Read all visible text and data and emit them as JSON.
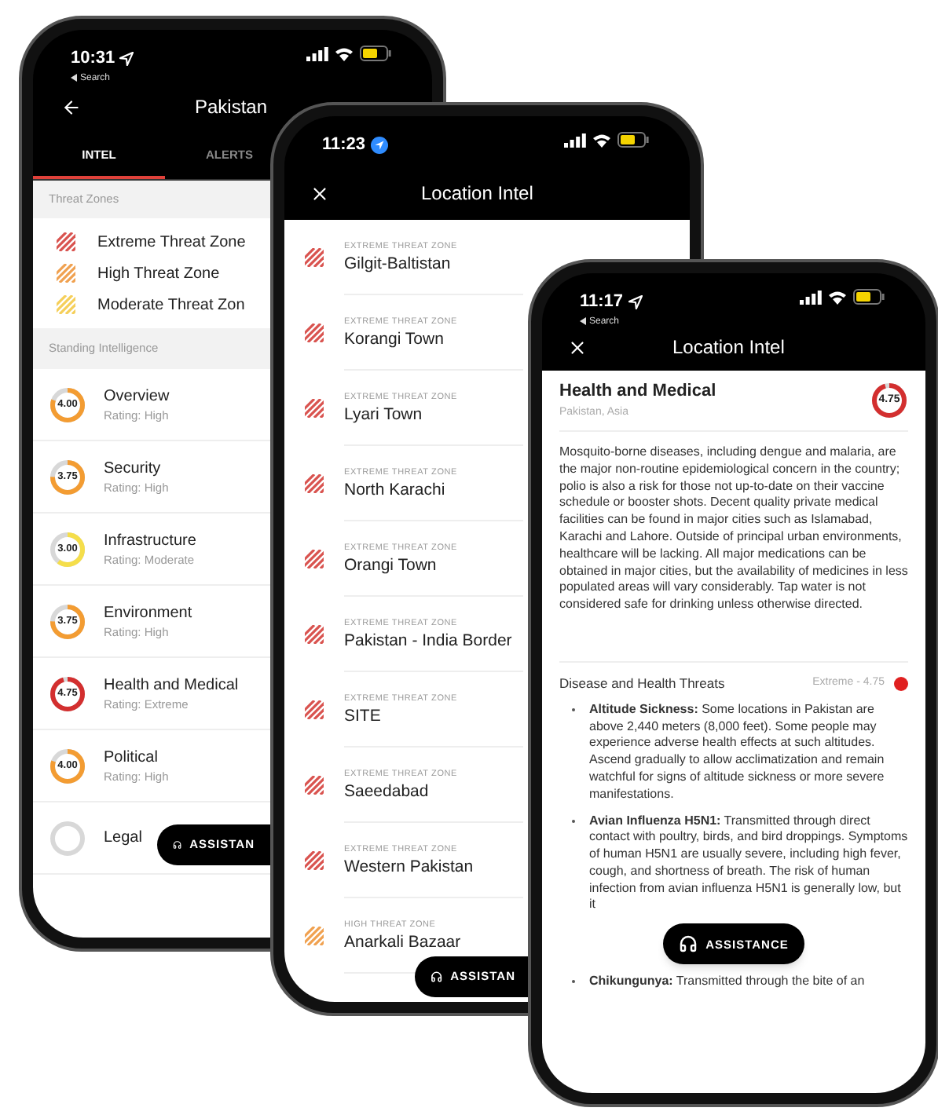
{
  "phone_country": {
    "status": {
      "time": "10:31",
      "back": "Search"
    },
    "title": "Pakistan",
    "tabs": [
      {
        "label": "INTEL",
        "selected": true
      },
      {
        "label": "ALERTS",
        "selected": false
      }
    ],
    "legend_header": "Threat Zones",
    "legend": [
      {
        "label": "Extreme Threat Zone",
        "color": "#d9534f"
      },
      {
        "label": "High Threat Zone",
        "color": "#f0a150"
      },
      {
        "label": "Moderate Threat Zon",
        "color": "#f5cf5a"
      }
    ],
    "section_header": "Standing Intelligence",
    "ratings": [
      {
        "name": "Overview",
        "rating": "Rating: High",
        "score": "4.00",
        "level": 0.8,
        "color": "#f39c32"
      },
      {
        "name": "Security",
        "rating": "Rating: High",
        "score": "3.75",
        "level": 0.75,
        "color": "#f39c32"
      },
      {
        "name": "Infrastructure",
        "rating": "Rating: Moderate",
        "score": "3.00",
        "level": 0.6,
        "color": "#f5de4a"
      },
      {
        "name": "Environment",
        "rating": "Rating: High",
        "score": "3.75",
        "level": 0.75,
        "color": "#f39c32"
      },
      {
        "name": "Health and Medical",
        "rating": "Rating: Extreme",
        "score": "4.75",
        "level": 0.95,
        "color": "#d32f2f"
      },
      {
        "name": "Political",
        "rating": "Rating: High",
        "score": "4.00",
        "level": 0.8,
        "color": "#f39c32"
      },
      {
        "name": "Legal"
      }
    ],
    "assist": "ASSISTAN"
  },
  "phone_zones": {
    "status": {
      "time": "11:23"
    },
    "title": "Location Intel",
    "zones": [
      {
        "label": "EXTREME THREAT ZONE",
        "name": "Gilgit-Baltistan",
        "color": "#d9534f"
      },
      {
        "label": "EXTREME THREAT ZONE",
        "name": "Korangi Town",
        "color": "#d9534f"
      },
      {
        "label": "EXTREME THREAT ZONE",
        "name": "Lyari Town",
        "color": "#d9534f"
      },
      {
        "label": "EXTREME THREAT ZONE",
        "name": "North Karachi",
        "color": "#d9534f"
      },
      {
        "label": "EXTREME THREAT ZONE",
        "name": "Orangi Town",
        "color": "#d9534f"
      },
      {
        "label": "EXTREME THREAT ZONE",
        "name": "Pakistan - India Border",
        "color": "#d9534f"
      },
      {
        "label": "EXTREME THREAT ZONE",
        "name": "SITE",
        "color": "#d9534f"
      },
      {
        "label": "EXTREME THREAT ZONE",
        "name": "Saeedabad",
        "color": "#d9534f"
      },
      {
        "label": "EXTREME THREAT ZONE",
        "name": "Western Pakistan",
        "color": "#d9534f"
      },
      {
        "label": "HIGH THREAT ZONE",
        "name": "Anarkali Bazaar",
        "color": "#f0a150"
      }
    ],
    "assist": "ASSISTAN"
  },
  "phone_detail": {
    "status": {
      "time": "11:17",
      "back": "Search"
    },
    "title": "Location Intel",
    "heading": "Health and Medical",
    "subtitle": "Pakistan, Asia",
    "score": "4.75",
    "level": 0.95,
    "color": "#d32f2f",
    "paragraph": "Mosquito-borne diseases, including dengue and malaria, are the major non-routine epidemiological concern in the country; polio is also a risk for those not up-to-date on their vaccine schedule or booster shots. Decent quality private medical facilities can be found in major cities such as Islamabad, Karachi and Lahore. Outside of principal urban environments, healthcare will be lacking. All major medications can be obtained in major cities, but the availability of medicines in less populated areas will vary considerably. Tap water is not considered safe for drinking unless otherwise directed.",
    "section": {
      "title": "Disease and Health Threats",
      "rating": "Extreme - 4.75",
      "color": "#e02020"
    },
    "threats": [
      "**Altitude Sickness:** Some locations in Pakistan are above 2,440 meters (8,000 feet). Some people may experience adverse health effects at such altitudes. Ascend gradually to allow acclimatization and remain watchful for signs of altitude sickness or more severe manifestations.",
      "**Avian Influenza H5N1:** Transmitted through direct contact with poultry, birds, and bird droppings. Symptoms of human H5N1 are usually severe, including high fever, cough, and shortness of breath. The risk of human infection from avian influenza H5N1 is generally low, but it",
      "**Chikungunya:** Transmitted through the bite of an"
    ],
    "assist": "ASSISTANCE"
  }
}
